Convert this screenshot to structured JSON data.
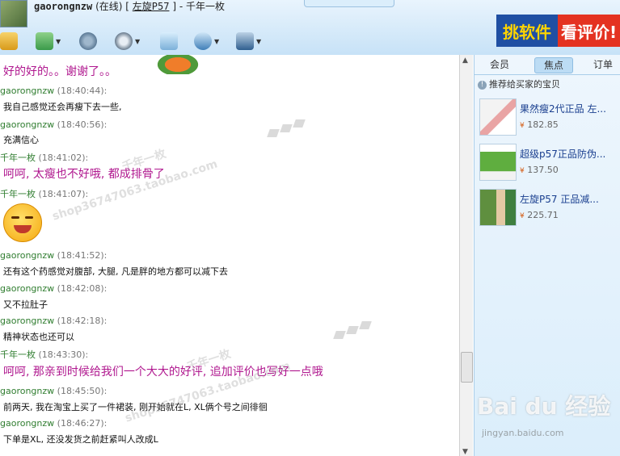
{
  "header": {
    "nickname": "gaorongnzw",
    "status": "(在线)",
    "bracket_open": "[",
    "shop_name": "左旋P57",
    "bracket_close": "]",
    "separator": "- 千年一枚"
  },
  "toolbar": {
    "buttons": [
      {
        "name": "exit-icon"
      },
      {
        "name": "transfer-file-icon"
      },
      {
        "name": "voice-icon"
      },
      {
        "name": "video-icon"
      },
      {
        "name": "message-icon"
      },
      {
        "name": "share-icon"
      },
      {
        "name": "more-icon"
      }
    ]
  },
  "ad": {
    "text1": "挑软件",
    "text2": "看评价!"
  },
  "chat": {
    "first_line": "好的好的。。谢谢了。。",
    "messages": [
      {
        "sender": "gaorongnzw",
        "time": "(18:40:44):",
        "text": "我自己感觉还会再瘦下去一些,"
      },
      {
        "sender": "gaorongnzw",
        "time": "(18:40:56):",
        "text": "充满信心"
      },
      {
        "sender": "千年一枚",
        "time": "(18:41:02):",
        "text": "呵呵, 太瘦也不好哦, 都成排骨了"
      },
      {
        "sender": "千年一枚",
        "time": "(18:41:07):",
        "text": ""
      },
      {
        "sender": "gaorongnzw",
        "time": "(18:41:52):",
        "text": "还有这个药感觉对腹部, 大腿, 凡是胖的地方都可以减下去"
      },
      {
        "sender": "gaorongnzw",
        "time": "(18:42:08):",
        "text": "又不拉肚子"
      },
      {
        "sender": "gaorongnzw",
        "time": "(18:42:18):",
        "text": "精神状态也还可以"
      },
      {
        "sender": "千年一枚",
        "time": "(18:43:30):",
        "text": "呵呵, 那亲到时候给我们一个大大的好评, 追加评价也写好一点哦"
      },
      {
        "sender": "gaorongnzw",
        "time": "(18:45:50):",
        "text": "前两天, 我在淘宝上买了一件裙装, 刚开始就在L, XL俩个号之间徘徊"
      },
      {
        "sender": "gaorongnzw",
        "time": "(18:46:27):",
        "text": "下单是XL, 还没发货之前赶紧叫人改成L"
      }
    ],
    "watermark_text": "shop36747063.taobao.com",
    "watermark_brand": "千年一枚"
  },
  "panel": {
    "tabs": [
      "会员",
      "焦点",
      "订单"
    ],
    "active_tab": "焦点",
    "rec_title": "推荐给买家的宝贝",
    "items": [
      {
        "name": "果然瘦2代正品 左...",
        "currency": "¥",
        "price": "182.85"
      },
      {
        "name": "超级p57正品防伪...",
        "currency": "¥",
        "price": "137.50"
      },
      {
        "name": "左旋P57 正品减...",
        "currency": "¥",
        "price": "225.71"
      }
    ]
  },
  "footer_watermark": {
    "brand": "Bai du 经验",
    "url": "jingyan.baidu.com"
  }
}
